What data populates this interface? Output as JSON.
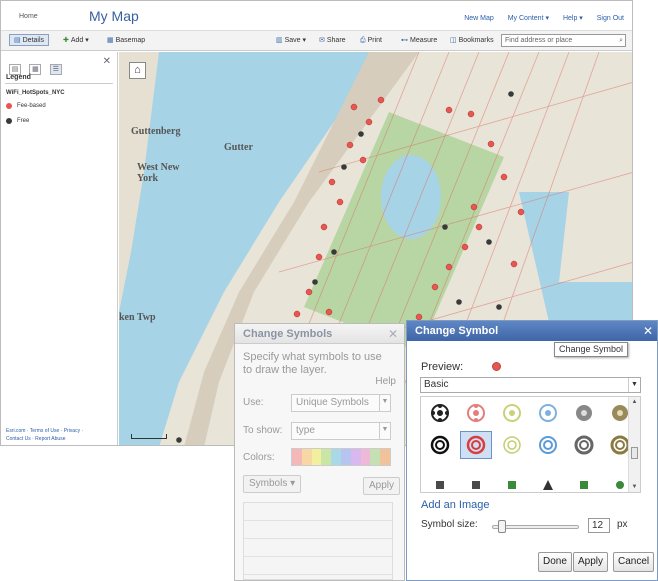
{
  "header": {
    "home": "Home",
    "map_title": "My Map",
    "links": [
      "New Map",
      "My Content ▾",
      "Help ▾",
      "Sign Out"
    ]
  },
  "toolbar": {
    "details": "Details",
    "add": "Add ▾",
    "basemap": "Basemap",
    "save": "Save ▾",
    "share": "Share",
    "print": "Print",
    "measure": "Measure",
    "bookmarks": "Bookmarks",
    "search_placeholder": "Find address or place"
  },
  "legend": {
    "heading": "Legend",
    "layer": "WiFi_HotSpots_NYC",
    "items": [
      {
        "label": "Fee-based",
        "color": "#e8574f"
      },
      {
        "label": "Free",
        "color": "#3a3a3a"
      }
    ],
    "footer": [
      "Esri.com · Terms of Use · Privacy ·",
      "Contact Us · Report Abuse"
    ]
  },
  "map": {
    "labels": [
      "Guttenberg",
      "West New York",
      "Gutter",
      "ken Twp"
    ]
  },
  "change_symbols": {
    "title": "Change Symbols",
    "description": "Specify what symbols to use to draw the layer.",
    "help": "Help",
    "use_label": "Use:",
    "use_value": "Unique Symbols",
    "show_label": "To show:",
    "show_value": "type",
    "colors_label": "Colors:",
    "symbols_button": "Symbols ▾",
    "apply_button": "Apply",
    "ramp": [
      "#f5b8b8",
      "#f7d7a3",
      "#f2ef9e",
      "#c9e6a4",
      "#a9d9e6",
      "#b8c4f0",
      "#d8b8ef",
      "#f0b8d8",
      "#c5e0b3",
      "#f2c29b"
    ]
  },
  "change_symbol": {
    "title": "Change Symbol",
    "tooltip": "Change Symbol",
    "preview_label": "Preview:",
    "category": "Basic",
    "add_image": "Add an Image",
    "size_label": "Symbol size:",
    "size_value": "12",
    "size_unit": "px",
    "size_fraction": 0.12,
    "buttons": {
      "done": "Done",
      "apply": "Apply",
      "cancel": "Cancel"
    }
  }
}
